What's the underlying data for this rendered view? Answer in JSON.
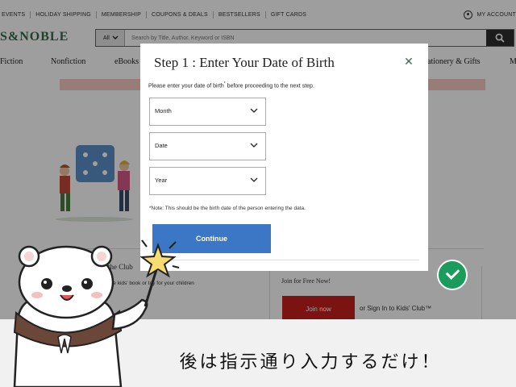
{
  "topbar": {
    "links": [
      "EVENTS",
      "HOLIDAY SHIPPING",
      "MEMBERSHIP",
      "COUPONS & DEALS",
      "BESTSELLERS",
      "GIFT CARDS"
    ],
    "account_label": "MY ACCOUNT"
  },
  "brand": {
    "logo_text": "S&NOBLE",
    "color": "#346b4a"
  },
  "search": {
    "category": "All",
    "placeholder": "Search by Title, Author, Keyword or ISBN"
  },
  "categories": [
    "Fiction",
    "Nonfiction",
    "eBooks",
    "ationery & Gifts",
    "M"
  ],
  "kids_club": {
    "title": "the Club",
    "description": "y one kids' book or toy for your children",
    "join_free": "Join for Free Now!",
    "join_button": "Join now",
    "sign_in": "or Sign In to Kids' Club™"
  },
  "modal": {
    "title": "Step 1 : Enter Your Date of Birth",
    "close_icon": "close-icon",
    "instruction_pre": "Please enter your date of birth",
    "instruction_mark": "*",
    "instruction_post": " before proceeding to the next step.",
    "selects": [
      {
        "label": "Month"
      },
      {
        "label": "Date"
      },
      {
        "label": "Year"
      }
    ],
    "note": "*Note: This should be the birth date of the person entering the data.",
    "continue_label": "Continue",
    "accent": "#3b77c4"
  },
  "caption": "後は指示通り入力するだけ！"
}
